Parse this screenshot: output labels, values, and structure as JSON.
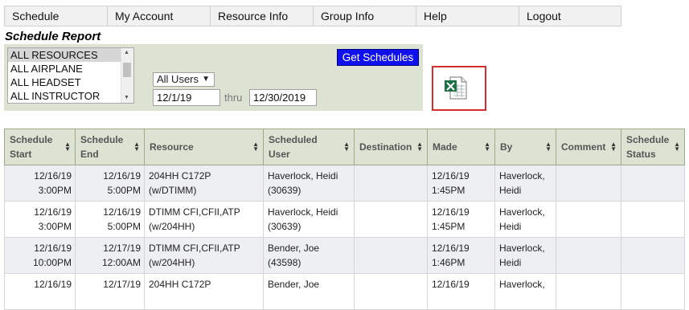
{
  "nav": {
    "items": [
      "Schedule",
      "My Account",
      "Resource Info",
      "Group Info",
      "Help",
      "Logout"
    ]
  },
  "page_title": "Schedule Report",
  "filters": {
    "resources": [
      "ALL RESOURCES",
      "ALL AIRPLANE",
      "ALL HEADSET",
      "ALL INSTRUCTOR"
    ],
    "selected_resource": "ALL RESOURCES",
    "users_select": "All Users",
    "date_from": "12/1/19",
    "thru_label": "thru",
    "date_to": "12/30/2019",
    "get_button": "Get Schedules"
  },
  "export": {
    "icon": "excel-export-icon"
  },
  "table": {
    "headers": [
      [
        "Schedule",
        "Start"
      ],
      [
        "Schedule",
        "End"
      ],
      [
        "Resource",
        ""
      ],
      [
        "Scheduled",
        "User"
      ],
      [
        "Destination",
        ""
      ],
      [
        "Made",
        ""
      ],
      [
        "By",
        ""
      ],
      [
        "Comment",
        ""
      ],
      [
        "Schedule",
        "Status"
      ]
    ],
    "rows": [
      {
        "start_date": "12/16/19",
        "start_time": "3:00PM",
        "end_date": "12/16/19",
        "end_time": "5:00PM",
        "resource1": "204HH C172P",
        "resource2": "(w/DTIMM)",
        "user1": "Haverlock, Heidi",
        "user2": "(30639)",
        "destination": "",
        "made_date": "12/16/19",
        "made_time": "1:45PM",
        "by1": "Haverlock,",
        "by2": "Heidi",
        "comment": "",
        "status": ""
      },
      {
        "start_date": "12/16/19",
        "start_time": "3:00PM",
        "end_date": "12/16/19",
        "end_time": "5:00PM",
        "resource1": "DTIMM CFI,CFII,ATP",
        "resource2": "(w/204HH)",
        "user1": "Haverlock, Heidi",
        "user2": "(30639)",
        "destination": "",
        "made_date": "12/16/19",
        "made_time": "1:45PM",
        "by1": "Haverlock,",
        "by2": "Heidi",
        "comment": "",
        "status": ""
      },
      {
        "start_date": "12/16/19",
        "start_time": "10:00PM",
        "end_date": "12/17/19",
        "end_time": "12:00AM",
        "resource1": "DTIMM CFI,CFII,ATP",
        "resource2": "(w/204HH)",
        "user1": "Bender, Joe",
        "user2": "(43598)",
        "destination": "",
        "made_date": "12/16/19",
        "made_time": "1:46PM",
        "by1": "Haverlock,",
        "by2": "Heidi",
        "comment": "",
        "status": ""
      },
      {
        "start_date": "12/16/19",
        "start_time": "",
        "end_date": "12/17/19",
        "end_time": "",
        "resource1": "204HH C172P",
        "resource2": "",
        "user1": "Bender, Joe",
        "user2": "",
        "destination": "",
        "made_date": "12/16/19",
        "made_time": "",
        "by1": "Haverlock,",
        "by2": "",
        "comment": "",
        "status": ""
      }
    ]
  },
  "colors": {
    "panel_bg": "#dde3d2",
    "button_blue": "#1010ee",
    "highlight_red": "#d32f2f",
    "excel_green": "#1e7145"
  }
}
